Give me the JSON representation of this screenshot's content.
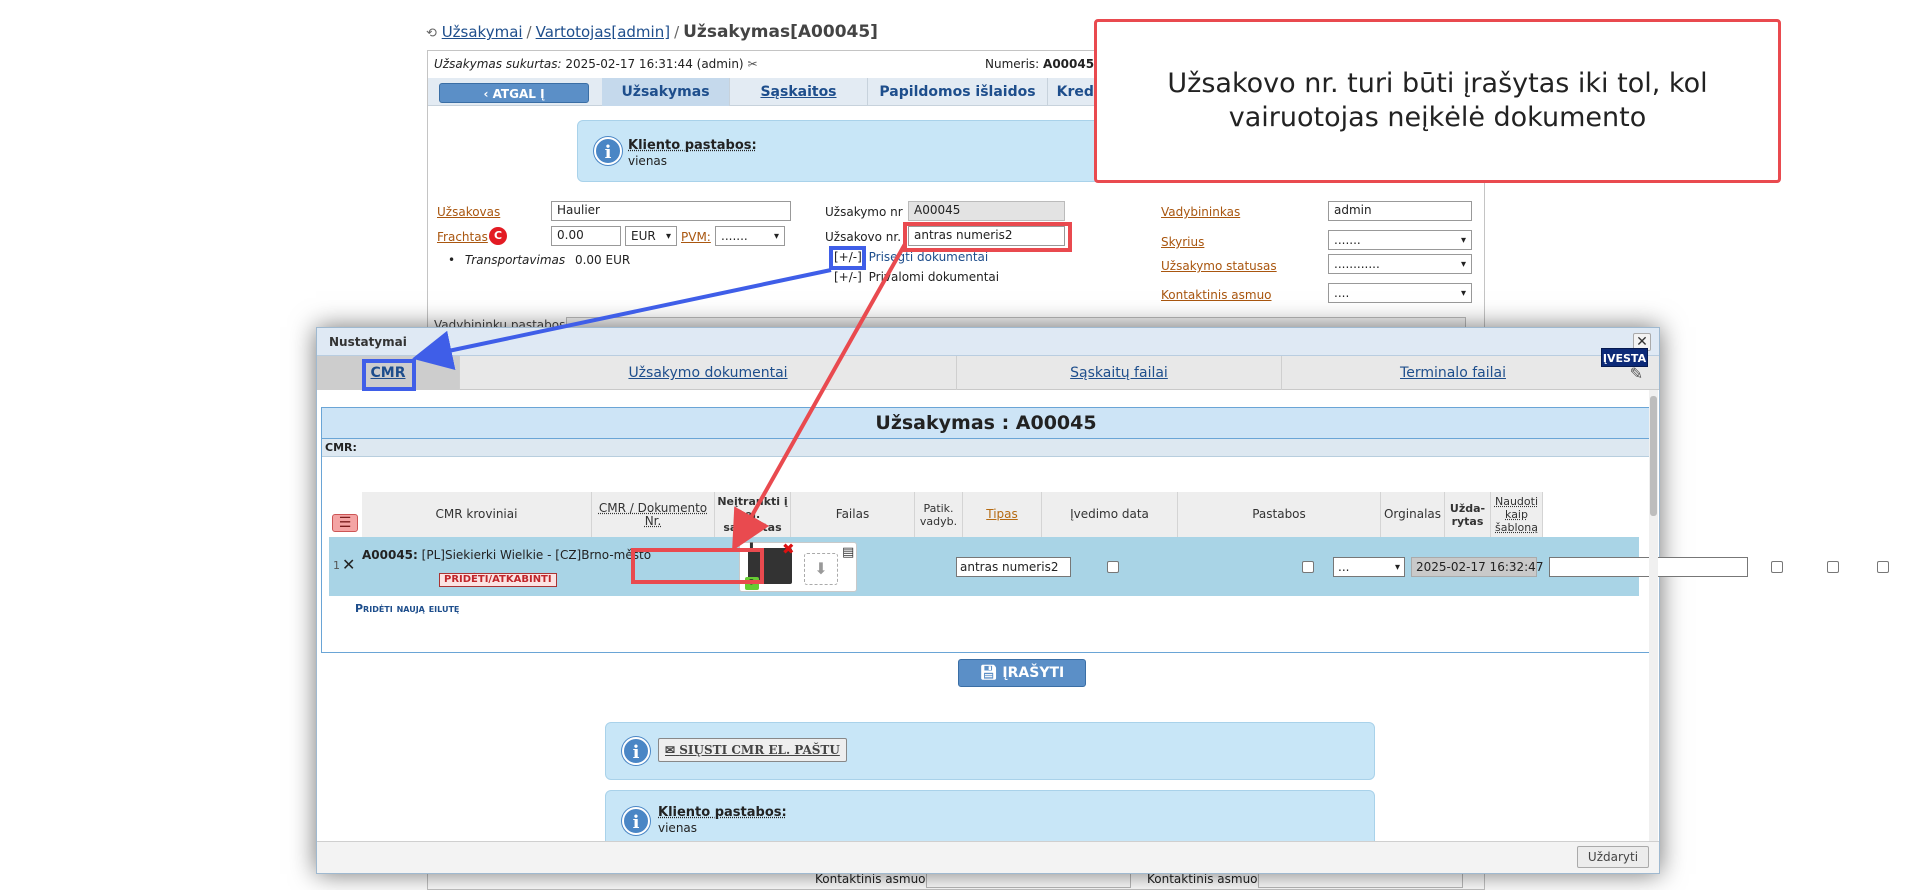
{
  "breadcrumb": {
    "items": [
      "Užsakymai",
      "Vartotojas[admin]"
    ],
    "separator": "/",
    "current": "Užsakymas[A00045]"
  },
  "order_meta": {
    "created_label": "Užsakymas sukurtas:",
    "created_value": "2025-02-17 16:31:44 (admin)",
    "number_label": "Numeris:",
    "number_value": "A00045"
  },
  "bg_tabs": {
    "back_label": "ATGAL Į UŽSAKYMUS",
    "items": [
      "Užsakymas",
      "Sąskaitos",
      "Papildomos išlaidos",
      "Kredit"
    ]
  },
  "bg_info": {
    "title": "Kliento pastabos:",
    "text": "vienas"
  },
  "bg_form": {
    "customer_label": "Užsakovas",
    "customer_value": "Haulier",
    "freight_label": "Frachtas",
    "freight_badge": "C",
    "freight_value": "0.00",
    "currency_value": "EUR",
    "vat_label": "PVM:",
    "vat_value": ".......",
    "transport_label": "Transportavimas",
    "transport_value": "0.00 EUR",
    "order_no_label": "Užsakymo nr",
    "order_no_value": "A00045",
    "customer_no_label": "Užsakovo nr.",
    "customer_no_value": "antras numeris2",
    "attached_toggle": "[+/-]",
    "attached_label": "Prisegti dokumentai",
    "required_toggle": "[+/-]",
    "required_label": "Privalomi dokumentai",
    "manager_label": "Vadybininkas",
    "manager_value": "admin",
    "department_label": "Skyrius",
    "department_value": ".......",
    "status_label": "Užsakymo statusas",
    "status_value": "............",
    "contact_label": "Kontaktinis asmuo",
    "contact_value": "....",
    "manager_notes_label": "Vadybininku pastabos :",
    "bottom_contact_1": "Kontaktinis asmuo",
    "bottom_contact_2": "Kontaktinis asmuo"
  },
  "callout": {
    "text": "Užsakovo nr. turi būti įrašytas iki tol, kol vairuotojas neįkėlė dokumento"
  },
  "modal": {
    "title": "Nustatymai",
    "close_glyph": "✕",
    "tabs": [
      "CMR",
      "Užsakymo dokumentai",
      "Sąskaitų failai",
      "Terminalo failai"
    ],
    "order_header": "Užsakymas : A00045",
    "cmr_label": "CMR:",
    "columns": [
      "CMR kroviniai",
      "CMR / Dokumento Nr.",
      "Neįtraukti į el. sąskaitas",
      "Failas",
      "Patik. vadyb.",
      "Tipas",
      "Įvedimo data",
      "Pastabos",
      "Orginalas",
      "Užda-rytas",
      "Naudoti kaip šabloną"
    ],
    "row": {
      "index": "1",
      "order_code": "A00045:",
      "route": "[PL]Siekierki Wielkie - [CZ]Brno-město",
      "attach_label": "PRIDĖTI/ATKABINTI",
      "doc_no": "antras numeris2",
      "type_value": "...",
      "entry_date": "2025-02-17 16:32:47",
      "notes": "",
      "status_label": "ĮVESTA"
    },
    "add_row_label": "Pridėti naują eilutę",
    "save_label": "ĮRAŠYTI",
    "send_cmr_label": "SIŲSTI CMR EL. PAŠTU",
    "info_title": "Kliento pastabos:",
    "info_text": "vienas",
    "footer_close": "Uždaryti"
  },
  "colors": {
    "annotation_red": "#e94a4f",
    "annotation_blue": "#3f5ee8",
    "accent_blue": "#5b8fc7",
    "status_navy": "#0c2a78",
    "row_highlight": "#a9d4e6"
  }
}
